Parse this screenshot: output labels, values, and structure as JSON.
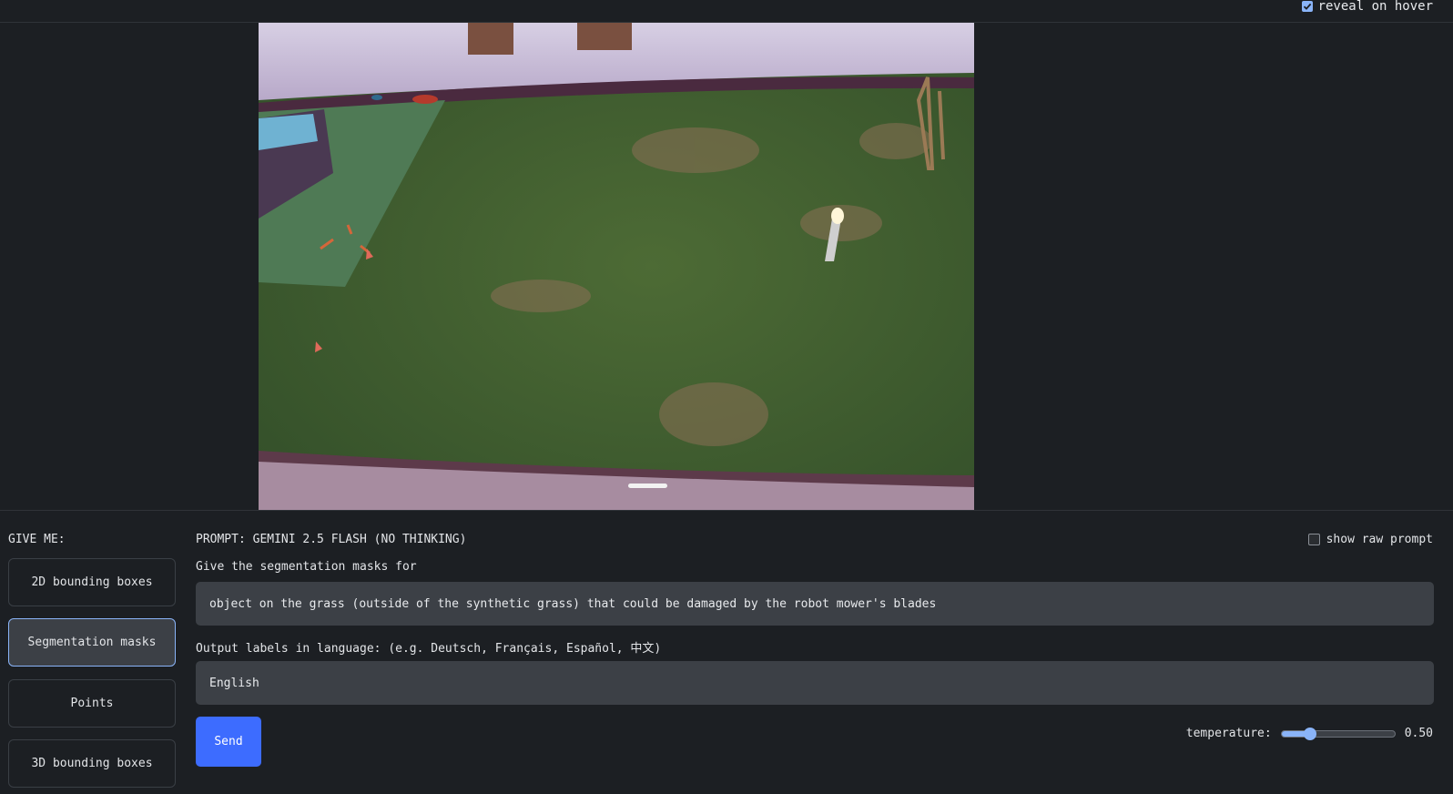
{
  "top": {
    "reveal_label": "reveal on hover",
    "reveal_checked": true
  },
  "image": {
    "icon": "photo-lawn-robot-mower-icon"
  },
  "give_me": {
    "label": "GIVE ME:",
    "options": [
      "2D bounding boxes",
      "Segmentation masks",
      "Points",
      "3D bounding boxes"
    ],
    "selected": "Segmentation masks"
  },
  "prompt": {
    "title": "PROMPT: GEMINI 2.5 FLASH (NO THINKING)",
    "show_raw_label": "show raw prompt",
    "show_raw_checked": false,
    "instruction": "Give the segmentation masks for",
    "query": "object on the grass (outside of the synthetic grass) that could be damaged by the robot mower's blades",
    "language_label": "Output labels in language: (e.g. Deutsch, Français, Español, 中文)",
    "language": "English",
    "send_label": "Send"
  },
  "temperature": {
    "label": "temperature:",
    "value": "0.50",
    "fraction": 0.25
  },
  "colors": {
    "accent": "#8ab4f8",
    "send": "#3d6cff",
    "bg": "#1c1f23",
    "field": "#3c4046"
  }
}
